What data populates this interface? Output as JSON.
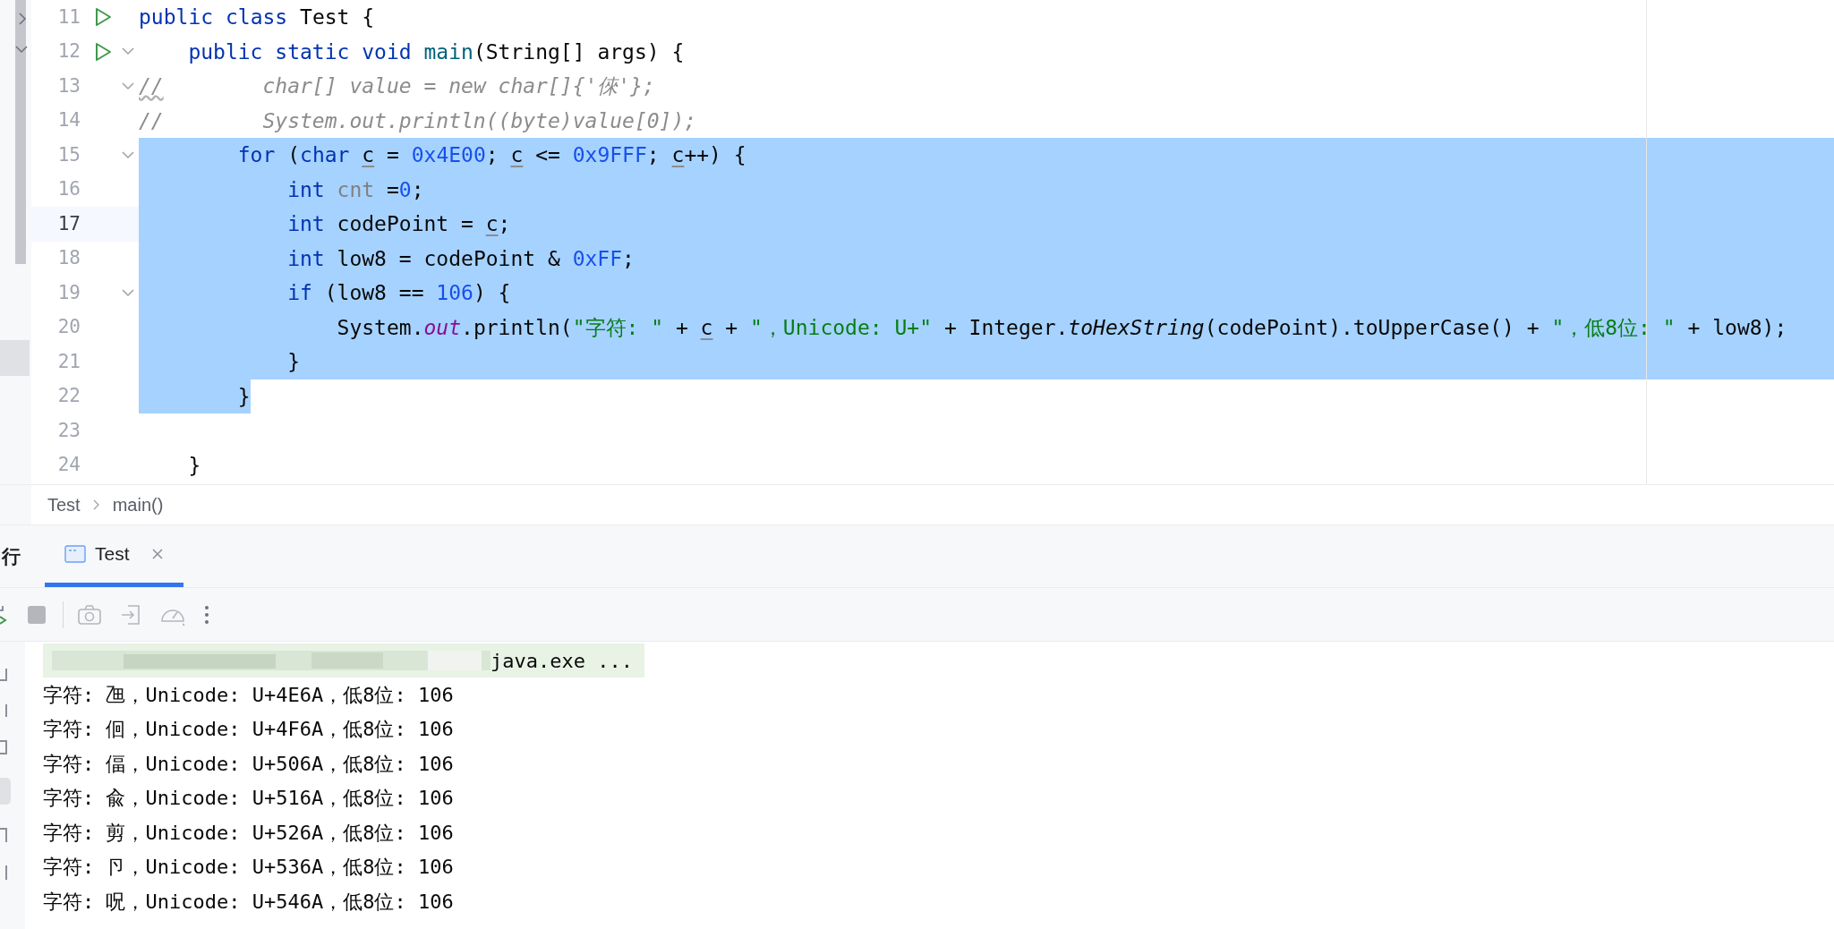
{
  "editor": {
    "lines": [
      {
        "number": "11",
        "run": true,
        "foldable": false,
        "current": false,
        "selected": false,
        "tokens": [
          {
            "text": "public",
            "kind": "kw"
          },
          {
            "text": " class",
            "kind": "kw"
          },
          {
            "text": " Test {",
            "kind": "plain"
          }
        ]
      },
      {
        "number": "12",
        "run": true,
        "foldable": true,
        "current": false,
        "selected": false,
        "tokens": [
          {
            "text": "    public",
            "kind": "kw"
          },
          {
            "text": " static",
            "kind": "kw"
          },
          {
            "text": " void",
            "kind": "kw"
          },
          {
            "text": " main",
            "kind": "method"
          },
          {
            "text": "(String[] args) {",
            "kind": "plain"
          }
        ]
      },
      {
        "number": "13",
        "run": false,
        "foldable": true,
        "current": false,
        "selected": false,
        "tokens": [
          {
            "text": "//",
            "kind": "comment-warn"
          },
          {
            "text": "        char[] value = new char[]{'倈'};",
            "kind": "comment"
          }
        ]
      },
      {
        "number": "14",
        "run": false,
        "foldable": false,
        "current": false,
        "selected": false,
        "tokens": [
          {
            "text": "//        System.out.println((byte)value[0]);",
            "kind": "comment"
          }
        ]
      },
      {
        "number": "15",
        "run": false,
        "foldable": true,
        "current": false,
        "selected": true,
        "tokens": [
          {
            "text": "        for",
            "kind": "kw"
          },
          {
            "text": " (",
            "kind": "plain"
          },
          {
            "text": "char ",
            "kind": "kw"
          },
          {
            "text": "c",
            "kind": "var"
          },
          {
            "text": " = ",
            "kind": "plain"
          },
          {
            "text": "0x4E00",
            "kind": "num"
          },
          {
            "text": "; ",
            "kind": "plain"
          },
          {
            "text": "c",
            "kind": "var"
          },
          {
            "text": " <= ",
            "kind": "plain"
          },
          {
            "text": "0x9FFF",
            "kind": "num"
          },
          {
            "text": "; ",
            "kind": "plain"
          },
          {
            "text": "c",
            "kind": "var"
          },
          {
            "text": "++) {",
            "kind": "plain"
          }
        ]
      },
      {
        "number": "16",
        "run": false,
        "foldable": false,
        "current": false,
        "selected": true,
        "tokens": [
          {
            "text": "            int",
            "kind": "kw"
          },
          {
            "text": " cnt",
            "kind": "unused"
          },
          {
            "text": " =",
            "kind": "plain"
          },
          {
            "text": "0",
            "kind": "num"
          },
          {
            "text": ";",
            "kind": "plain"
          }
        ]
      },
      {
        "number": "17",
        "run": false,
        "foldable": false,
        "current": true,
        "selected": true,
        "tokens": [
          {
            "text": "            int",
            "kind": "kw"
          },
          {
            "text": " codePoint = ",
            "kind": "plain"
          },
          {
            "text": "c",
            "kind": "var"
          },
          {
            "text": ";",
            "kind": "plain"
          }
        ]
      },
      {
        "number": "18",
        "run": false,
        "foldable": false,
        "current": false,
        "selected": true,
        "tokens": [
          {
            "text": "            int",
            "kind": "kw"
          },
          {
            "text": " low8 = codePoint & ",
            "kind": "plain"
          },
          {
            "text": "0xFF",
            "kind": "num"
          },
          {
            "text": ";",
            "kind": "plain"
          }
        ]
      },
      {
        "number": "19",
        "run": false,
        "foldable": true,
        "current": false,
        "selected": true,
        "tokens": [
          {
            "text": "            if",
            "kind": "kw"
          },
          {
            "text": " (low8 == ",
            "kind": "plain"
          },
          {
            "text": "106",
            "kind": "num"
          },
          {
            "text": ") {",
            "kind": "plain"
          }
        ]
      },
      {
        "number": "20",
        "run": false,
        "foldable": false,
        "current": false,
        "selected": true,
        "tokens": [
          {
            "text": "                System.",
            "kind": "plain"
          },
          {
            "text": "out",
            "kind": "field"
          },
          {
            "text": ".println(",
            "kind": "plain"
          },
          {
            "text": "\"字符: \"",
            "kind": "str"
          },
          {
            "text": " + ",
            "kind": "plain"
          },
          {
            "text": "c",
            "kind": "var"
          },
          {
            "text": " + ",
            "kind": "plain"
          },
          {
            "text": "\"，Unicode: U+\"",
            "kind": "str"
          },
          {
            "text": " + Integer.",
            "kind": "plain"
          },
          {
            "text": "toHexString",
            "kind": "static"
          },
          {
            "text": "(codePoint).toUpperCase() + ",
            "kind": "plain"
          },
          {
            "text": "\"，低8位: \"",
            "kind": "str"
          },
          {
            "text": " + low8);",
            "kind": "plain"
          }
        ]
      },
      {
        "number": "21",
        "run": false,
        "foldable": false,
        "current": false,
        "selected": true,
        "tokens": [
          {
            "text": "            }",
            "kind": "plain"
          }
        ]
      },
      {
        "number": "22",
        "run": false,
        "foldable": false,
        "current": false,
        "selected": true,
        "tokens": [
          {
            "text": "        }",
            "kind": "plain"
          }
        ]
      },
      {
        "number": "23",
        "run": false,
        "foldable": false,
        "current": false,
        "selected": false
      },
      {
        "number": "24",
        "run": false,
        "foldable": false,
        "current": false,
        "selected": false,
        "tokens": [
          {
            "text": "    }",
            "kind": "plain"
          }
        ]
      }
    ]
  },
  "breadcrumb": [
    "Test",
    "main()"
  ],
  "tool_window": {
    "title": "行",
    "tabs": [
      {
        "label": "Test",
        "selected": true
      }
    ]
  },
  "console": {
    "command": "java.exe ...",
    "lines": [
      "字符: 乪，Unicode: U+4E6A，低8位: 106",
      "字符: 佪，Unicode: U+4F6A，低8位: 106",
      "字符: 偪，Unicode: U+506A，低8位: 106",
      "字符: 兪，Unicode: U+516A，低8位: 106",
      "字符: 剪，Unicode: U+526A，低8位: 106",
      "字符: 卪，Unicode: U+536A，低8位: 106",
      "字符: 呪，Unicode: U+546A，低8位: 106"
    ]
  }
}
